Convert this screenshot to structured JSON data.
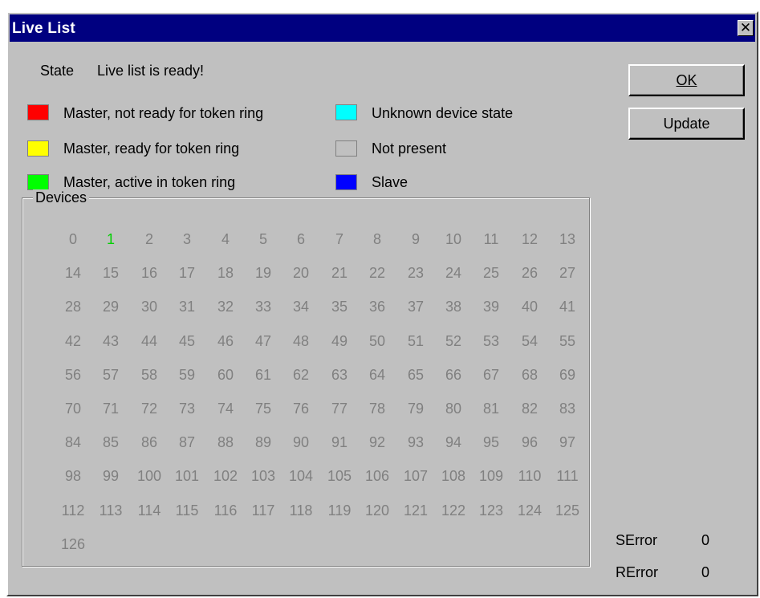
{
  "window": {
    "title": "Live List",
    "close_glyph": "✕"
  },
  "state": {
    "label": "State",
    "value": "Live list is ready!"
  },
  "legend": [
    {
      "color": "#ff0000",
      "label": "Master, not ready for token ring"
    },
    {
      "color": "#ffff00",
      "label": "Master, ready for token ring"
    },
    {
      "color": "#00ff00",
      "label": "Master, active in token ring"
    },
    {
      "color": "#00ffff",
      "label": "Unknown device state"
    },
    {
      "color": "#c0c0c0",
      "label": "Not present"
    },
    {
      "color": "#0000ff",
      "label": "Slave"
    }
  ],
  "buttons": {
    "ok_label": "OK",
    "update_label": "Update"
  },
  "devices": {
    "title": "Devices",
    "count": 127,
    "per_row": 14,
    "active": [
      1
    ],
    "not_present_color": "#808080",
    "active_color": "#00d000"
  },
  "errors": {
    "serror_label": "SError",
    "serror_value": "0",
    "rerror_label": "RError",
    "rerror_value": "0"
  }
}
